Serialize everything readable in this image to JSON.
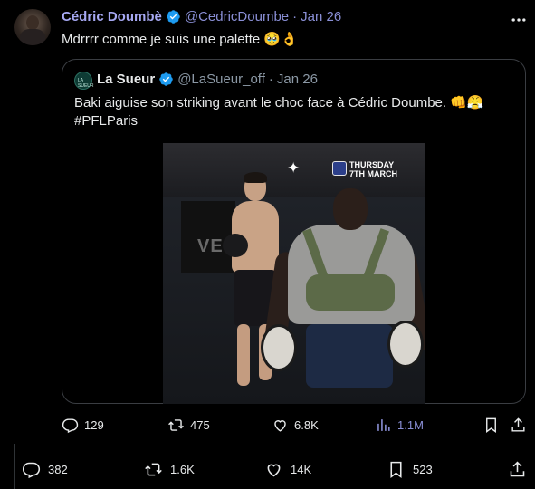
{
  "quoted_by": {
    "name": "Cédric Doumbè",
    "handle": "@CedricDoumbe",
    "separator": "·",
    "date": "Jan 26",
    "text": "Mdrrrr comme je suis une palette",
    "emojis": "🥹👌"
  },
  "quote": {
    "avatar_label": "LA SUEUR",
    "name": "La Sueur",
    "handle": "@LaSueur_off",
    "separator": "·",
    "date": "Jan 26",
    "text_line1": "Baki aiguise son striking avant le choc face à Cédric Doumbe.",
    "text_emojis": "👊😤",
    "hashtag": "#PFLParis",
    "media": {
      "banner_text": "VENU",
      "event_line1": "THURSDAY",
      "event_line2": "7TH MARCH",
      "sparkle": "✦"
    },
    "actions": {
      "replies": "129",
      "reposts": "475",
      "likes": "6.8K",
      "views": "1.1M"
    }
  },
  "main_actions": {
    "replies": "382",
    "reposts": "1.6K",
    "likes": "14K",
    "bookmarks": "523"
  },
  "icons": {
    "verified": "verified-badge-icon",
    "more": "more-dots-icon",
    "reply": "reply-bubble-icon",
    "repost": "repost-arrows-icon",
    "like": "heart-icon",
    "views": "views-bar-chart-icon",
    "bookmark": "bookmark-icon",
    "share": "share-upload-icon"
  },
  "colors": {
    "background": "#000000",
    "verified_blue": "#1d9bf0",
    "name_highlight": "#a6a8f2",
    "text": "#e7e9ea",
    "muted": "#8b98a5"
  }
}
